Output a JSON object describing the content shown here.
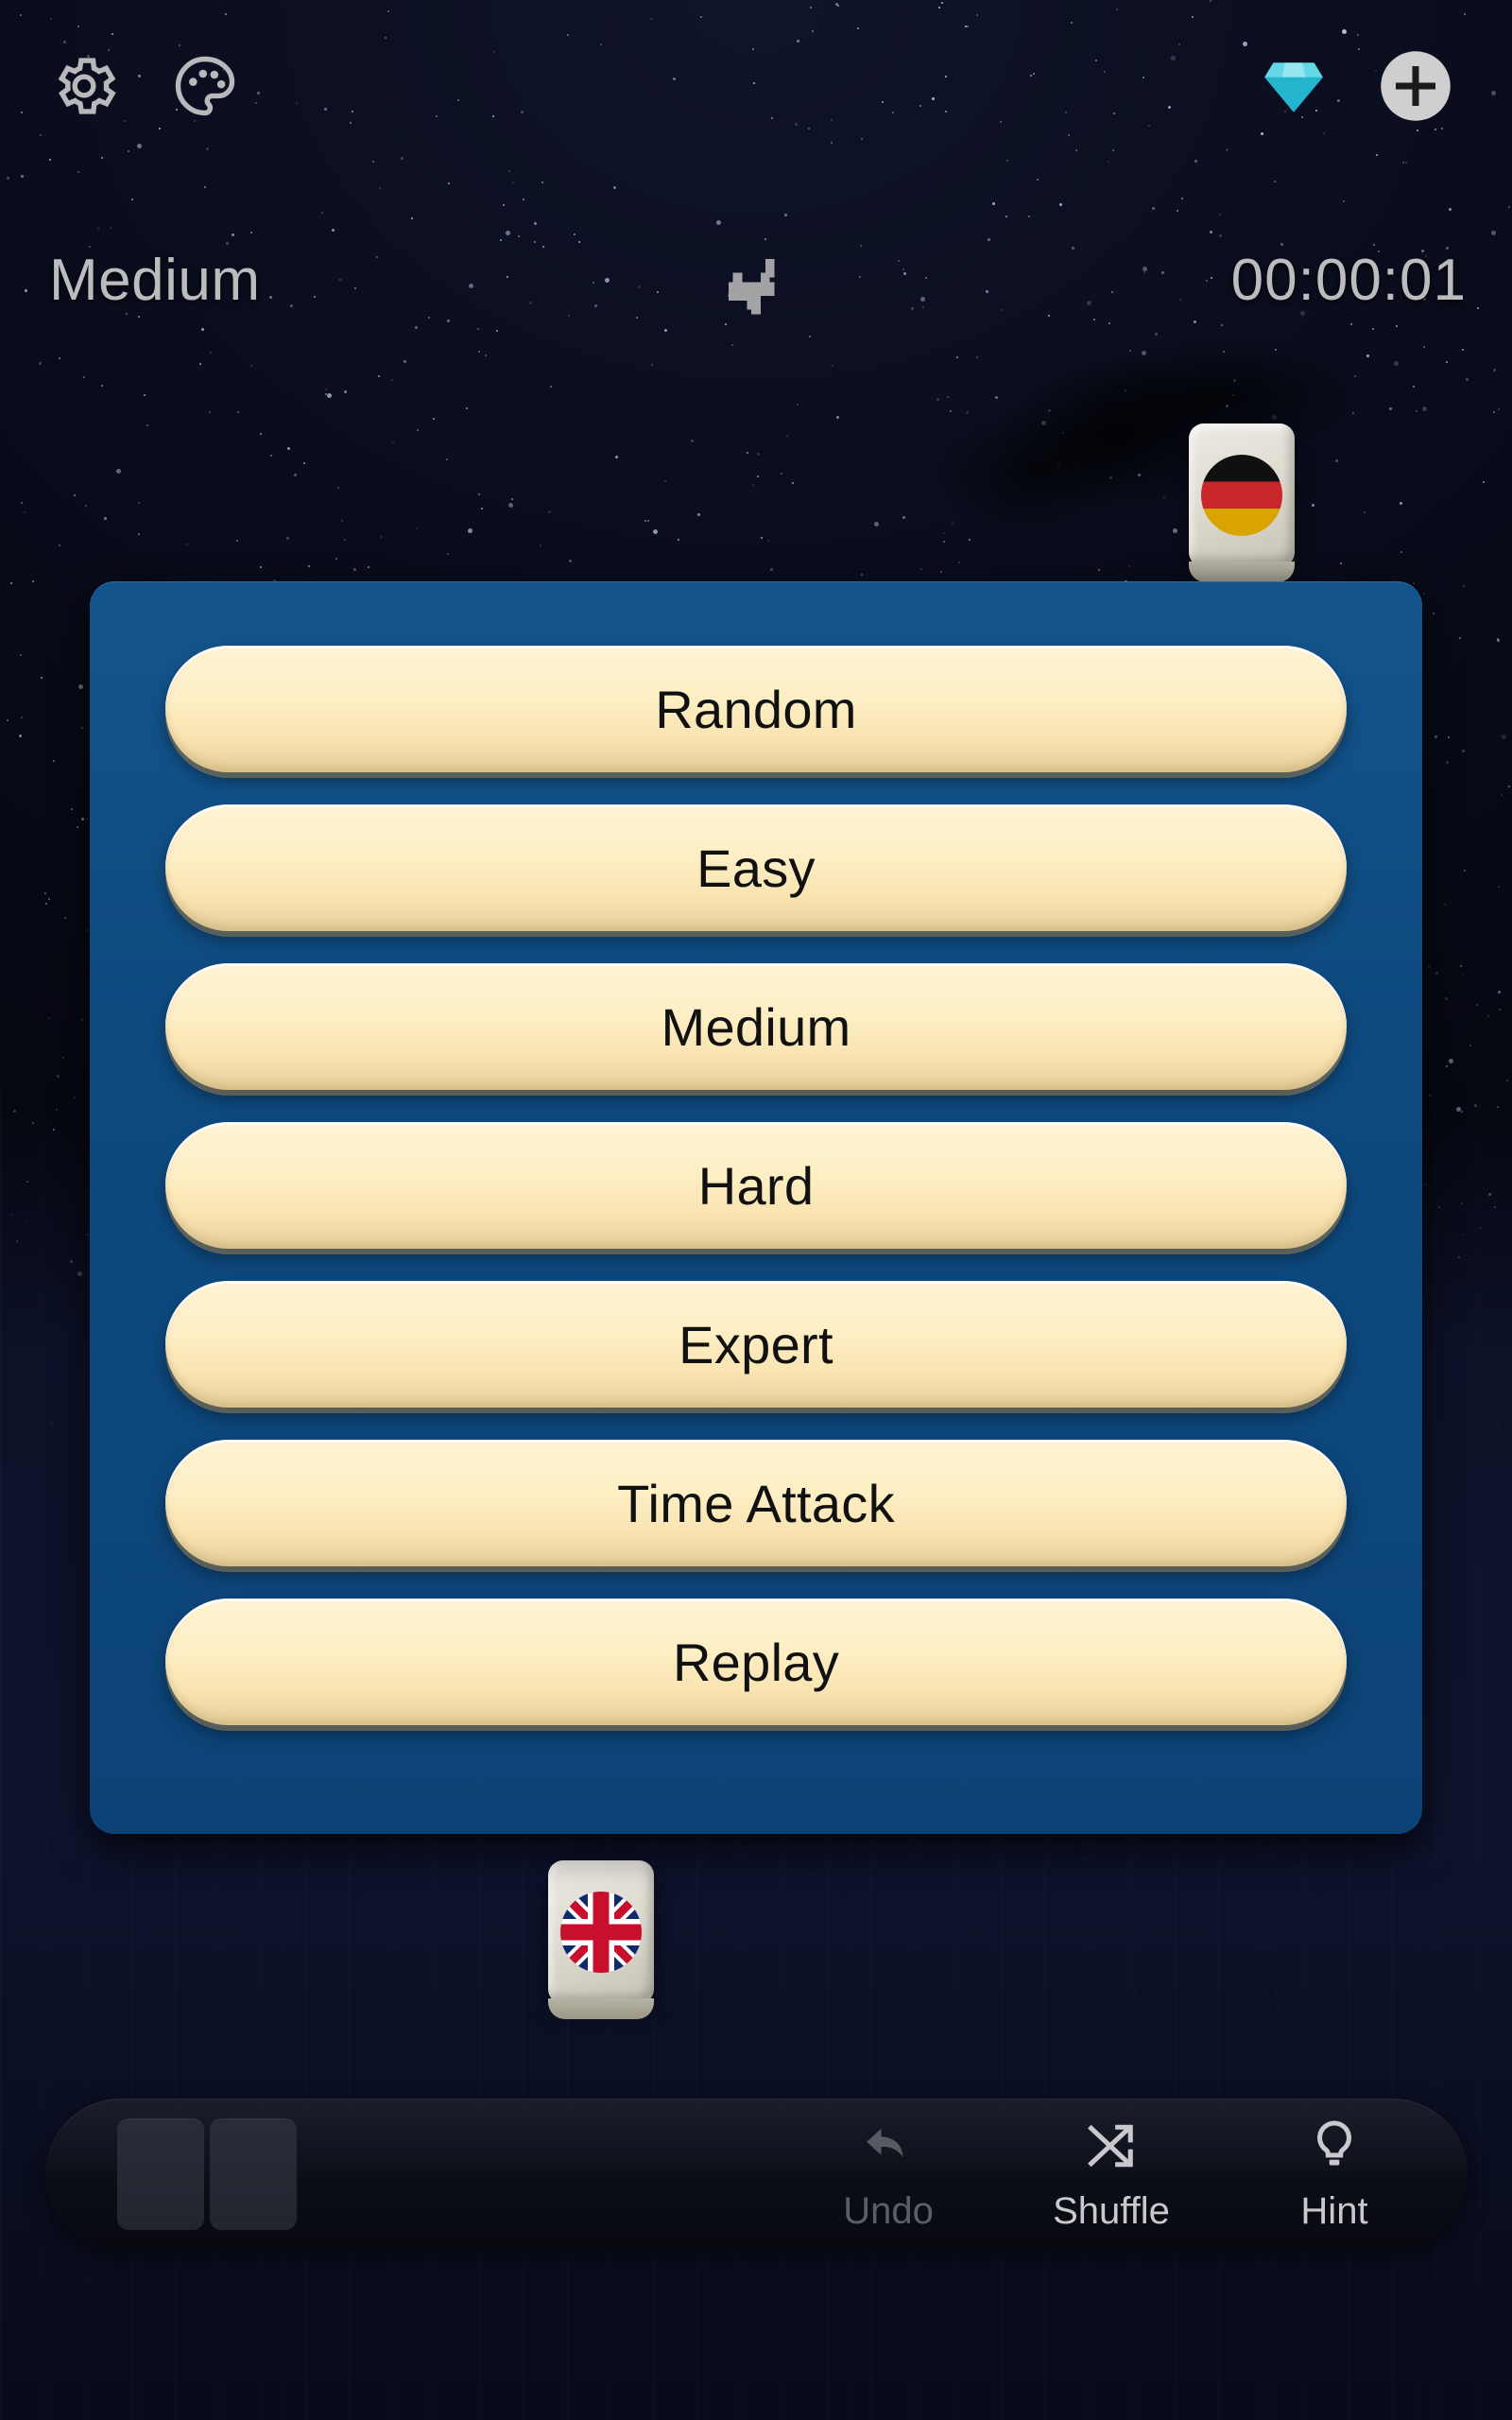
{
  "topbar": {
    "settings_icon": "gear-icon",
    "theme_icon": "palette-icon",
    "gem_icon": "diamond-gem-icon",
    "add_icon": "plus-icon"
  },
  "status": {
    "difficulty": "Medium",
    "timer": "00:00:01",
    "tiles_indicator_icon": "checkmark-icon"
  },
  "board": {
    "tiles": [
      {
        "name": "tile-german",
        "flag": "Germany"
      },
      {
        "name": "tile-uk",
        "flag": "United Kingdom"
      }
    ]
  },
  "dialog": {
    "title": "",
    "buttons": [
      {
        "label": "Random"
      },
      {
        "label": "Easy"
      },
      {
        "label": "Medium"
      },
      {
        "label": "Hard"
      },
      {
        "label": "Expert"
      },
      {
        "label": "Time Attack"
      },
      {
        "label": "Replay"
      }
    ]
  },
  "toolbar": {
    "undo_label": "Undo",
    "shuffle_label": "Shuffle",
    "hint_label": "Hint",
    "undo_icon": "undo-arrow-icon",
    "shuffle_icon": "shuffle-arrows-icon",
    "hint_icon": "lightbulb-icon",
    "match_slot_count": 2
  },
  "colors": {
    "dialog_blue": "#0E4A80",
    "button_cream": "#FDEEC4",
    "gem_cyan": "#2CC3D8",
    "text_gray": "#BCBCBE",
    "flag_de_red": "#C8262A",
    "flag_de_gold": "#D9A400",
    "flag_gb_blue": "#0D2A6B",
    "flag_gb_red": "#C8102E"
  }
}
